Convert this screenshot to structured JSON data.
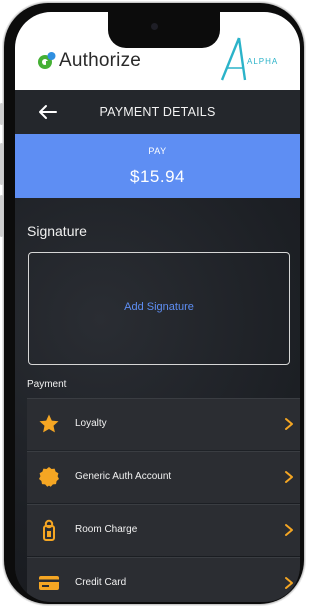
{
  "brand": {
    "app_name": "Authorize",
    "partner_badge": "ALPHA"
  },
  "header": {
    "title": "PAYMENT DETAILS",
    "back_icon": "arrow-left-icon"
  },
  "pay": {
    "label": "PAY",
    "amount": "$15.94"
  },
  "signature": {
    "label": "Signature",
    "add_label": "Add Signature"
  },
  "payment": {
    "label": "Payment",
    "methods": [
      {
        "label": "Loyalty",
        "icon": "star-icon"
      },
      {
        "label": "Generic Auth Account",
        "icon": "seal-badge-icon"
      },
      {
        "label": "Room Charge",
        "icon": "door-hanger-icon"
      },
      {
        "label": "Credit Card",
        "icon": "credit-card-icon"
      }
    ]
  },
  "colors": {
    "accent_blue": "#5e8ef3",
    "icon_orange": "#f5a623",
    "chevron": "#f5a623",
    "panel": "#2b2d32"
  }
}
